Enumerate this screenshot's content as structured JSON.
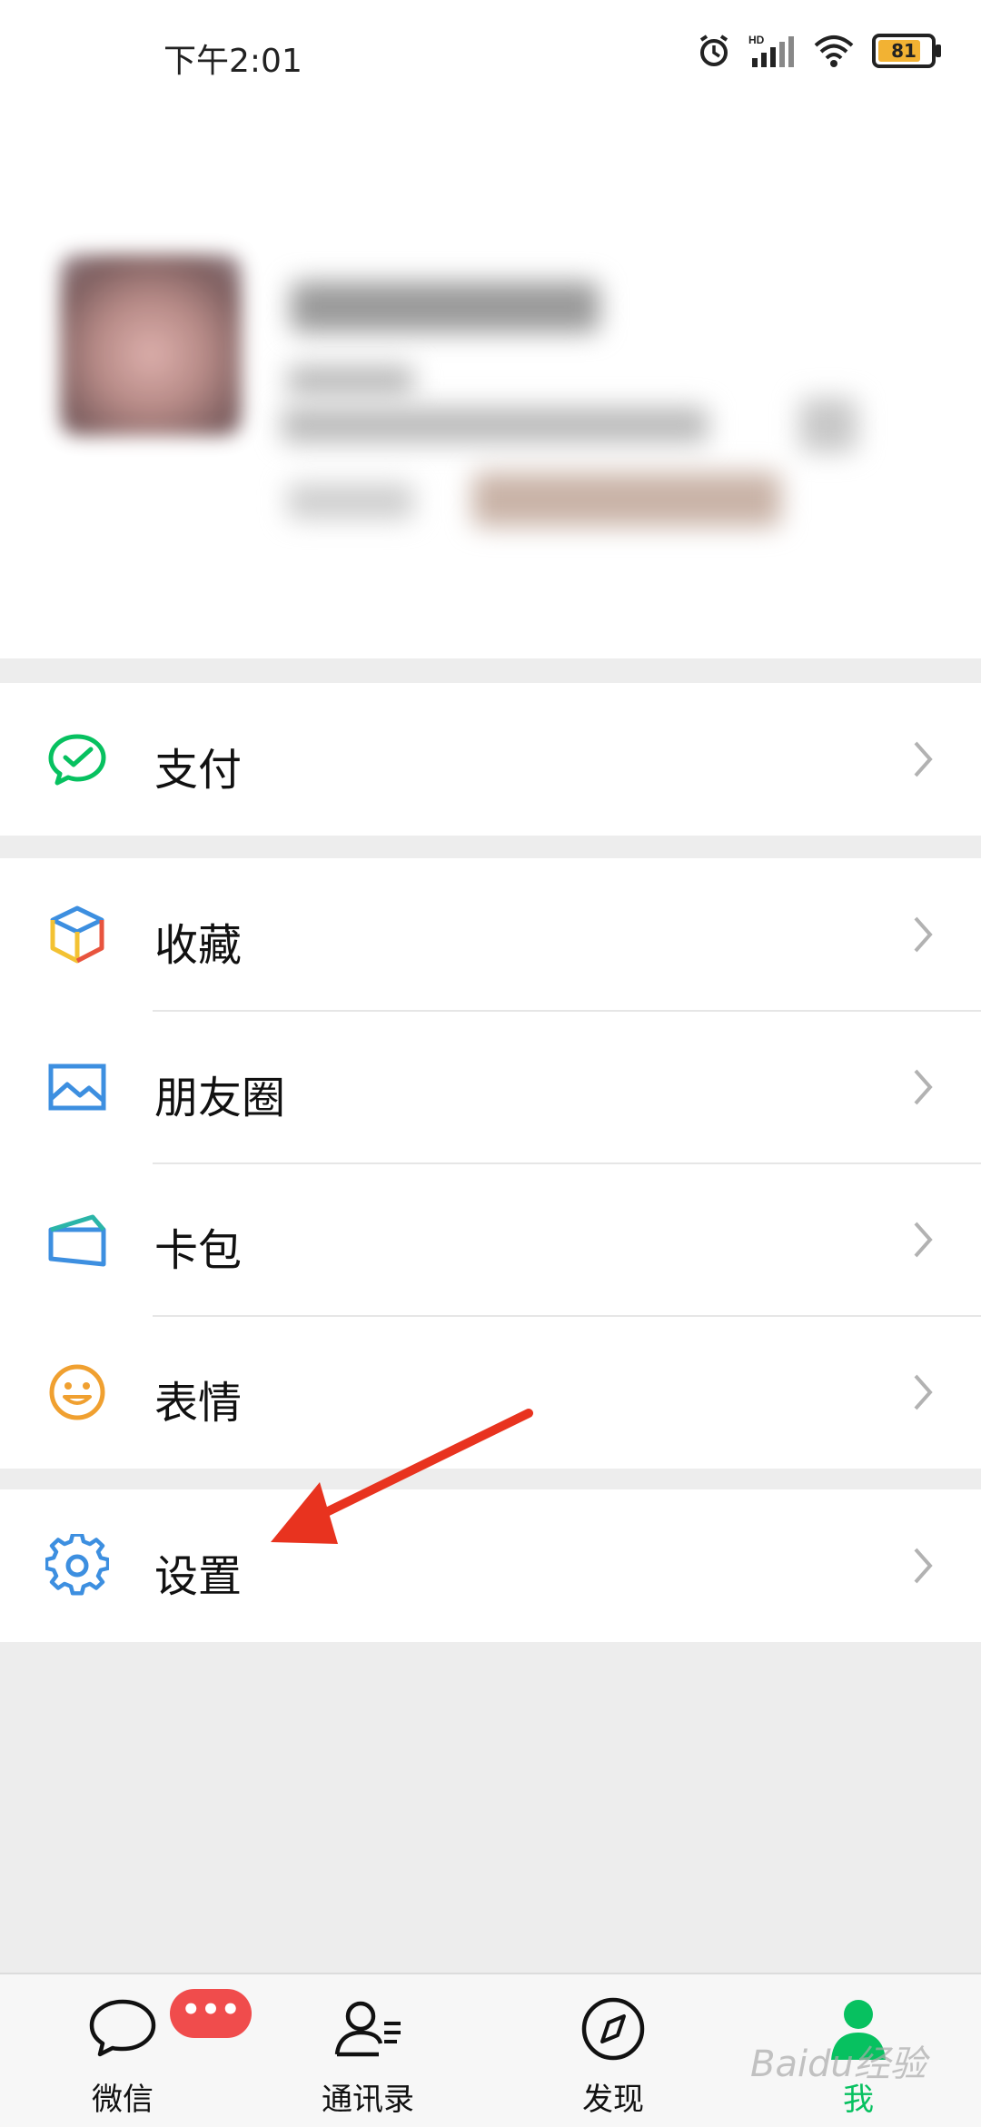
{
  "status_bar": {
    "time": "下午2:01",
    "battery": "81",
    "signal": "HD"
  },
  "menu": {
    "pay": "支付",
    "favorites": "收藏",
    "moments": "朋友圈",
    "cards": "卡包",
    "stickers": "表情",
    "settings": "设置"
  },
  "tabbar": {
    "chats": "微信",
    "chats_badge": "•••",
    "contacts": "通讯录",
    "discover": "发现",
    "me": "我"
  },
  "watermark": "Baidu经验",
  "colors": {
    "accent": "#07c160",
    "arrow": "#e8331f",
    "badge": "#f04c4c"
  }
}
